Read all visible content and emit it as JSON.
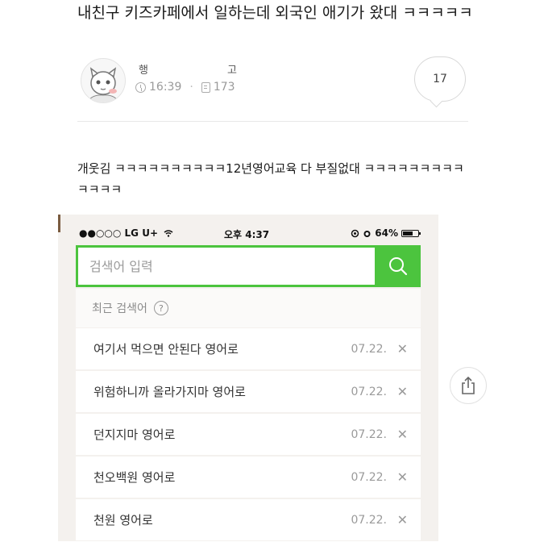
{
  "post": {
    "title": "내친구 키즈카페에서 일하는데 외국인 애기가 왔대 ㅋㅋㅋㅋㅋ",
    "author_start": "행",
    "author_end": "고",
    "time": "16:39",
    "views": "173",
    "comment_count": "17",
    "body": "개웃김 ㅋㅋㅋㅋㅋㅋㅋㅋㅋㅋ12년영어교육 다 부질없대 ㅋㅋㅋㅋㅋㅋㅋㅋㅋㅋㅋㅋㅋ"
  },
  "phone": {
    "carrier": "●●○○○ LG U+",
    "time": "오후 4:37",
    "battery": "64%",
    "search_placeholder": "검색어 입력",
    "recent_label": "최근 검색어",
    "help_symbol": "?",
    "recent": [
      {
        "text": "여기서 먹으면 안된다 영어로",
        "date": "07.22."
      },
      {
        "text": "위험하니까 올라가지마 영어로",
        "date": "07.22."
      },
      {
        "text": "던지지마 영어로",
        "date": "07.22."
      },
      {
        "text": "천오백원 영어로",
        "date": "07.22."
      },
      {
        "text": "천원 영어로",
        "date": "07.22."
      }
    ],
    "delete_symbol": "✕"
  },
  "colors": {
    "accent": "#4cc43e"
  },
  "icons": [
    "avatar-icon",
    "clock-icon",
    "doc-icon",
    "wifi-icon",
    "alarm-icon",
    "battery-icon",
    "search-icon",
    "help-icon",
    "close-icon",
    "share-icon"
  ]
}
